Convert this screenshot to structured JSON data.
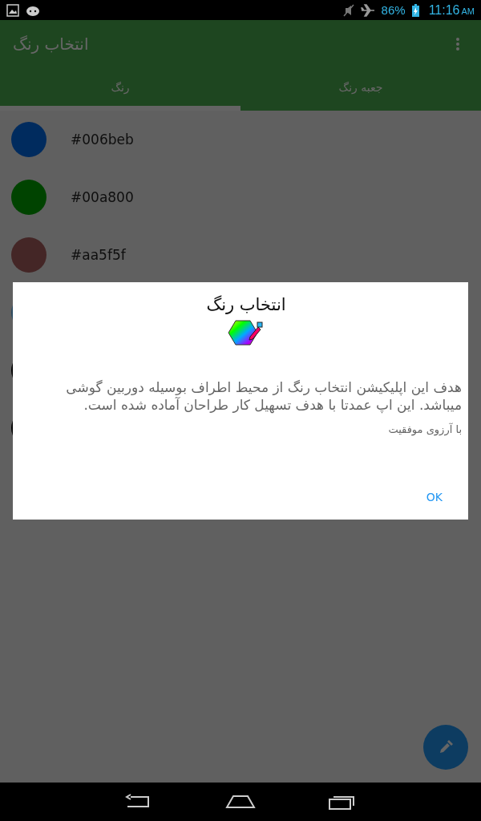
{
  "status_bar": {
    "battery": "86%",
    "time": "11:16",
    "ampm": "AM"
  },
  "app_bar": {
    "title": "انتخاب رنگ"
  },
  "tabs": [
    {
      "label": "جعبه رنگ",
      "selected": false
    },
    {
      "label": "رنگ",
      "selected": true
    }
  ],
  "colors": [
    {
      "hex": "#006beb",
      "color": "#002b5e"
    },
    {
      "hex": "#00a800",
      "color": "#004300"
    },
    {
      "hex": "#aa5f5f",
      "color": "#442626"
    },
    {
      "color": "#2a4a60"
    },
    {
      "color": "#000000"
    },
    {
      "color": "#000000"
    }
  ],
  "dialog": {
    "title": "انتخاب رنگ",
    "message": "هدف این اپلیکیشن انتخاب رنگ از محیط اطراف بوسیله دوربین گوشی میباشد. این اپ عمدتا با هدف تسهیل کار طراحان آماده شده است.",
    "signature": "با آرزوی موفقیت",
    "button": "OK"
  }
}
